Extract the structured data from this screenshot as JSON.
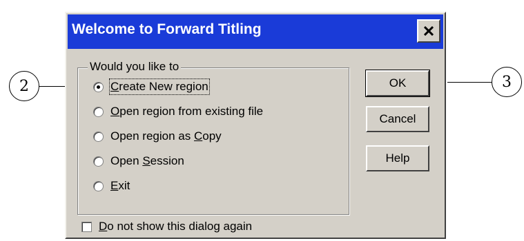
{
  "dialog": {
    "title": "Welcome to Forward Titling",
    "group_label": "Would you like to",
    "options": [
      {
        "pre": "",
        "key": "C",
        "post": "reate New region",
        "checked": true
      },
      {
        "pre": "",
        "key": "O",
        "post": "pen region from existing file",
        "checked": false
      },
      {
        "pre": "Open region as ",
        "key": "C",
        "post": "opy",
        "checked": false
      },
      {
        "pre": "Open ",
        "key": "S",
        "post": "ession",
        "checked": false
      },
      {
        "pre": "",
        "key": "E",
        "post": "xit",
        "checked": false
      }
    ],
    "buttons": {
      "ok": "OK",
      "cancel": "Cancel",
      "help": "Help"
    },
    "checkbox": {
      "key": "D",
      "post": "o not show this dialog again",
      "checked": false
    }
  },
  "callouts": {
    "left": "2",
    "right": "3"
  },
  "icons": {
    "close": "close-icon"
  }
}
